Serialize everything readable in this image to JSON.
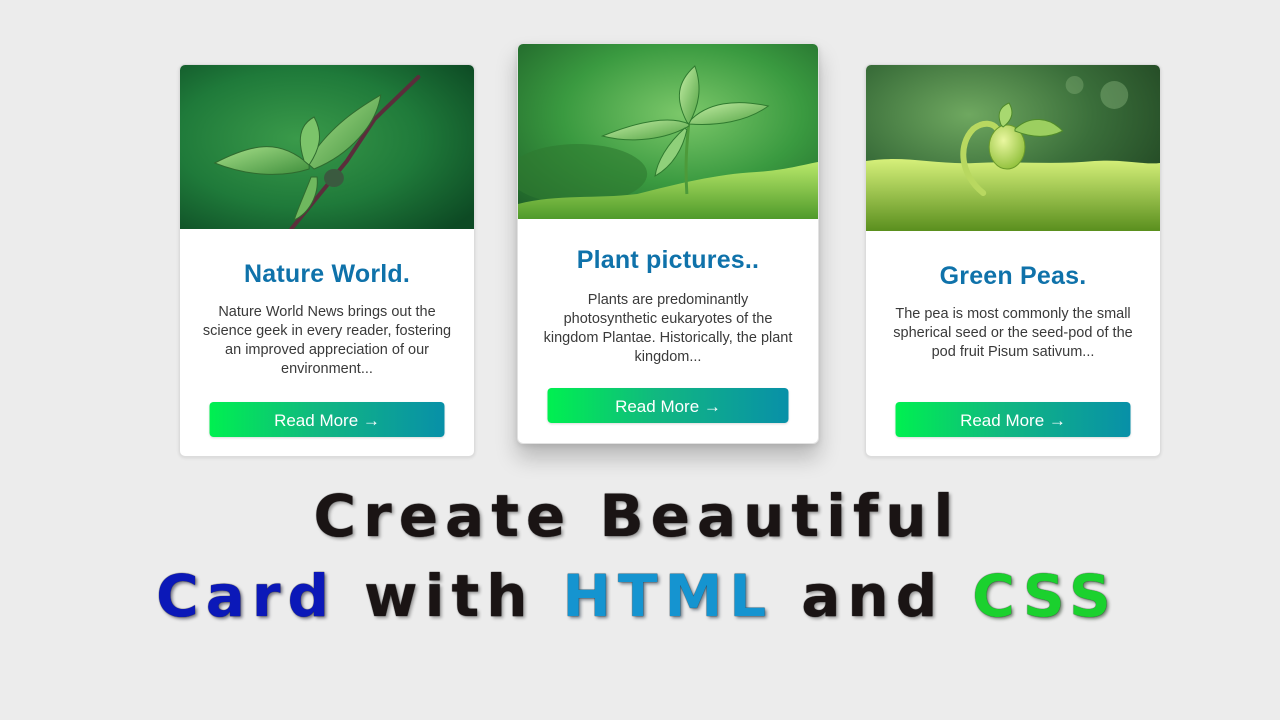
{
  "cards": [
    {
      "title": "Nature World.",
      "text": "Nature World News brings out the science geek in every reader, fostering an improved appreciation of our environment...",
      "button_label": "Read More →",
      "image_icon": "sprout-on-branch-image"
    },
    {
      "title": "Plant pictures..",
      "text": "Plants are predominantly photosynthetic eukaryotes of the kingdom Plantae. Historically, the plant kingdom...",
      "button_label": "Read More →",
      "image_icon": "young-plant-on-moss-image"
    },
    {
      "title": "Green Peas.",
      "text": "The pea is most commonly the small spherical seed or the seed-pod of the pod fruit Pisum sativum...",
      "button_label": "Read More →",
      "image_icon": "pea-seedling-image"
    }
  ],
  "headline": {
    "line1": "Create Beautiful",
    "line2": {
      "word1": "Card",
      "word2": "with",
      "word3": "HTML",
      "word4": "and",
      "word5": "CSS"
    }
  },
  "colors": {
    "background": "#ececec",
    "title_blue": "#0f72aa",
    "button_gradient_start": "#00f050",
    "button_gradient_end": "#0890a8",
    "card_word": "#0b18b8",
    "html_word": "#1594d0",
    "css_word": "#1bd12e"
  }
}
